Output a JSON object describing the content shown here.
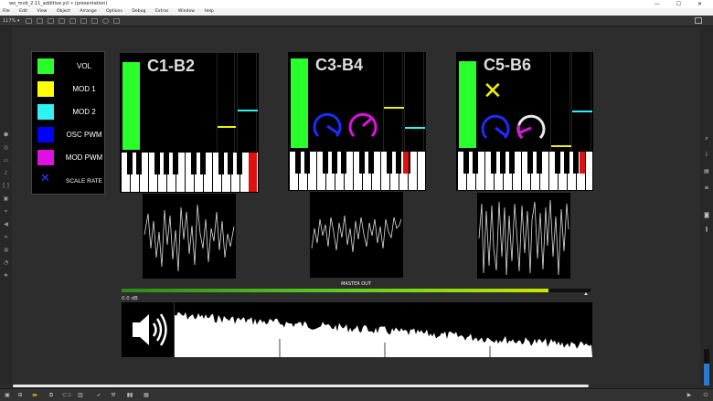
{
  "window": {
    "title": "wo_mvb_2.11_additive.ycl • (presentation)"
  },
  "menu": [
    "File",
    "Edit",
    "View",
    "Object",
    "Arrange",
    "Options",
    "Debug",
    "Extras",
    "Window",
    "Help"
  ],
  "toolbar": {
    "zoom": "117% ▾"
  },
  "legend": [
    {
      "label": "VOL",
      "color": "#2bff2b"
    },
    {
      "label": "MOD 1",
      "color": "#ffff00"
    },
    {
      "label": "MOD 2",
      "color": "#2ff3f3"
    },
    {
      "label": "OSC PWM",
      "color": "#0000ff"
    },
    {
      "label": "MOD PWM",
      "color": "#e010e0"
    },
    {
      "label": "SCALE RATE",
      "color": "#2740ff",
      "icon": "x-mark-icon"
    }
  ],
  "synths": [
    {
      "title": "C1-B2"
    },
    {
      "title": "C3-B4"
    },
    {
      "title": "C5-B6"
    }
  ],
  "master": {
    "label": "MASTER OUT",
    "level_db": "0.0 dB",
    "meter_fill": 0.91
  },
  "colors": {
    "green": "#2bff2b",
    "yellow": "#f0f000",
    "cyan": "#2ff3f3",
    "blue": "#1c2cff",
    "magenta": "#e010e0",
    "red": "#e01010"
  }
}
